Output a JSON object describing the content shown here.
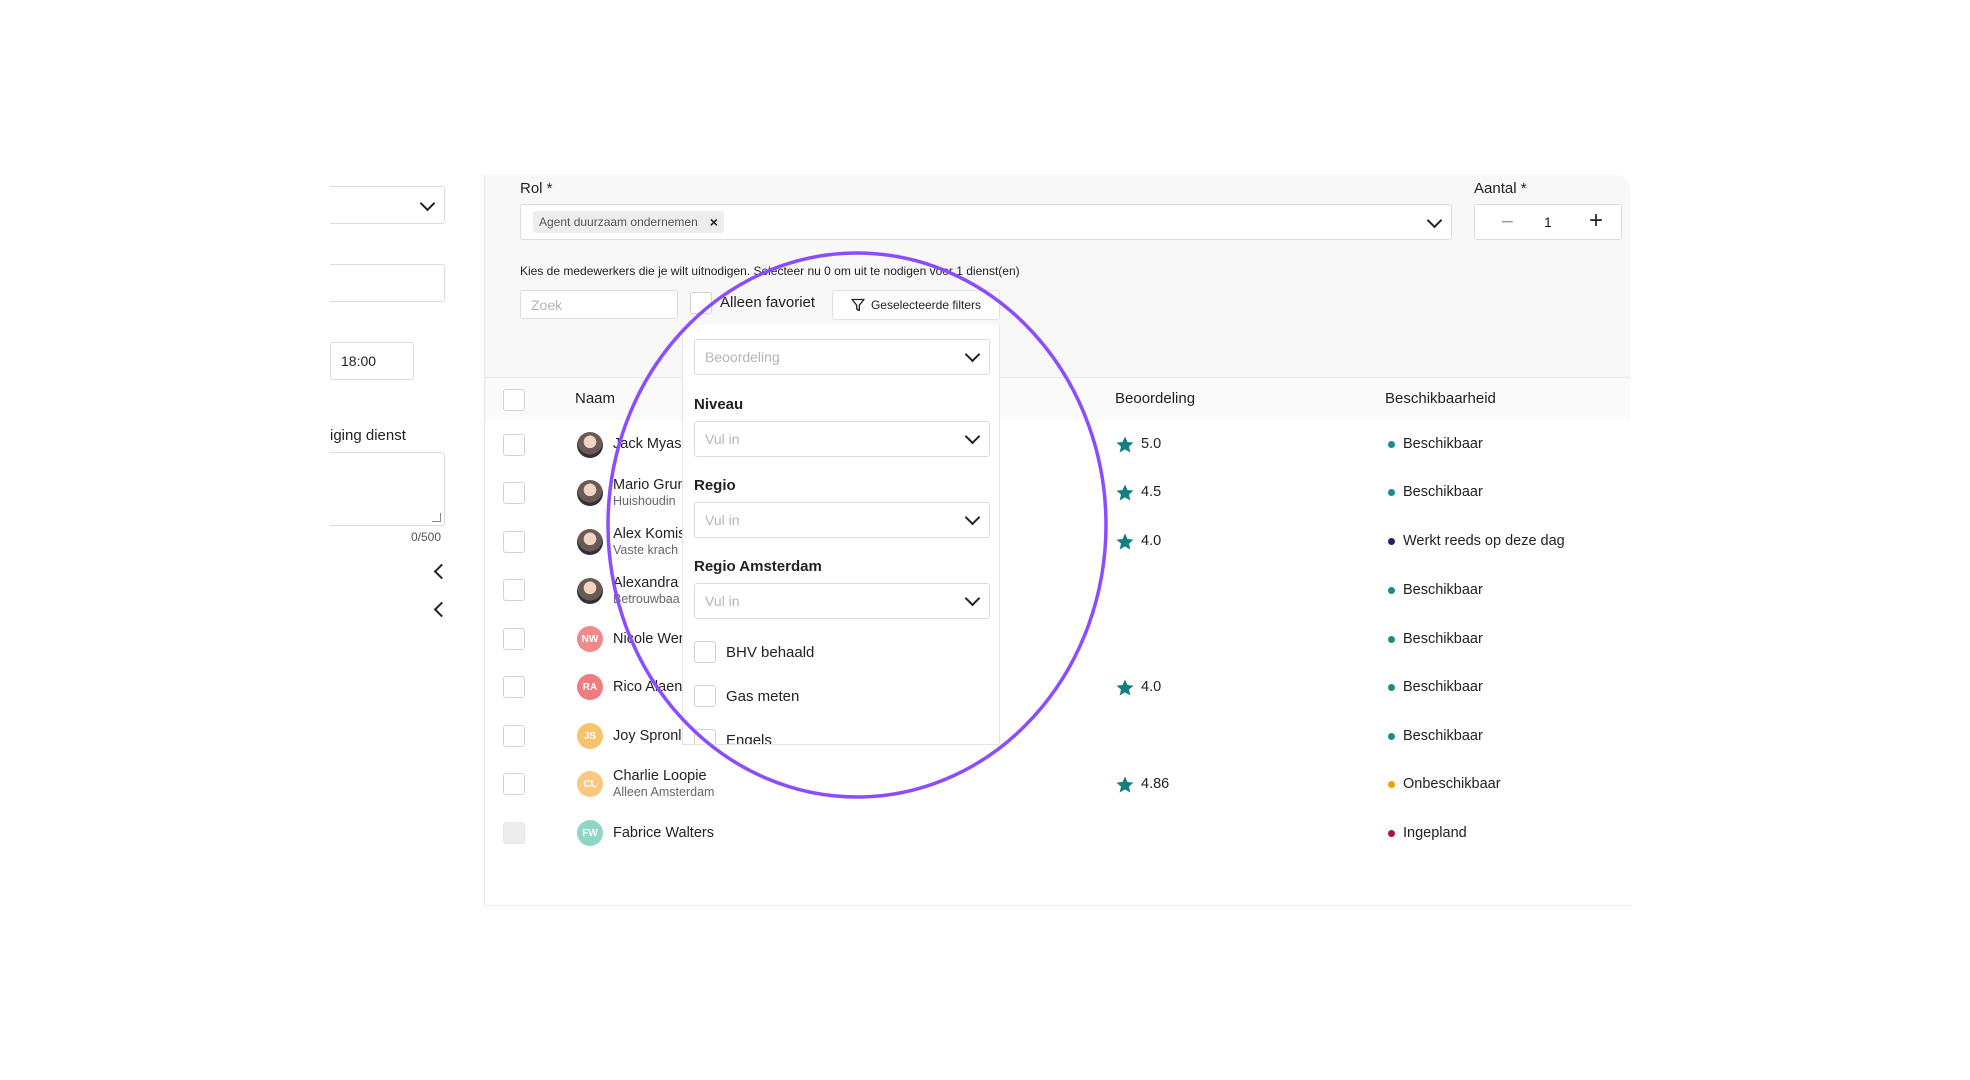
{
  "left_panel": {
    "time_value": "18:00",
    "description_label_partial": "iging dienst",
    "char_count": "0/500"
  },
  "role": {
    "label": "Rol *",
    "tag": "Agent duurzaam ondernemen",
    "tag_remove": "×"
  },
  "amount": {
    "label": "Aantal *",
    "value": "1",
    "minus": "−",
    "plus": "+"
  },
  "instructions": "Kies de medewerkers die je wilt uitnodigen. Selecteer nu 0 om uit te nodigen voor 1 dienst(en)",
  "search": {
    "placeholder": "Zoek"
  },
  "favorite_label": "Alleen favoriet",
  "filters_button": "Geselecteerde filters",
  "filter_panel": {
    "rating_placeholder": "Beoordeling",
    "level_label": "Niveau",
    "level_placeholder": "Vul in",
    "region_label": "Regio",
    "region_placeholder": "Vul in",
    "region_ams_label": "Regio Amsterdam",
    "region_ams_placeholder": "Vul in",
    "checks": [
      "BHV behaald",
      "Gas meten",
      "Engels"
    ]
  },
  "table": {
    "headers": {
      "name": "Naam",
      "rating": "Beoordeling",
      "availability": "Beschikbaarheid"
    },
    "rows": [
      {
        "name": "Jack Myas",
        "sub": "",
        "initials": "",
        "rating": "5.0",
        "availability": "Beschikbaar"
      },
      {
        "name": "Mario Grun",
        "sub": "Huishoudin",
        "initials": "",
        "rating": "4.5",
        "availability": "Beschikbaar"
      },
      {
        "name": "Alex Komis",
        "sub": "Vaste krach",
        "initials": "",
        "rating": "4.0",
        "availability": "Werkt reeds op deze dag"
      },
      {
        "name": "Alexandra",
        "sub": "Betrouwbaa",
        "initials": "",
        "rating": "",
        "availability": "Beschikbaar"
      },
      {
        "name": "Nicole Wer",
        "sub": "",
        "initials": "NW",
        "rating": "",
        "availability": "Beschikbaar"
      },
      {
        "name": "Rico Alaen",
        "sub": "",
        "initials": "RA",
        "rating": "4.0",
        "availability": "Beschikbaar"
      },
      {
        "name": "Joy Spronl",
        "sub": "",
        "initials": "JS",
        "rating": "",
        "availability": "Beschikbaar"
      },
      {
        "name": "Charlie Loopie",
        "sub": "Alleen Amsterdam",
        "initials": "CL",
        "rating": "4.86",
        "availability": "Onbeschikbaar"
      },
      {
        "name": "Fabrice Walters",
        "sub": "",
        "initials": "FW",
        "rating": "",
        "availability": "Ingepland"
      }
    ]
  },
  "colors": {
    "accent_teal": "#137f7f",
    "highlight_circle": "#8b4dff",
    "available": "#1a8a8a",
    "working": "#2b1a6e",
    "unavailable": "#f0a000",
    "scheduled": "#b0103a"
  }
}
